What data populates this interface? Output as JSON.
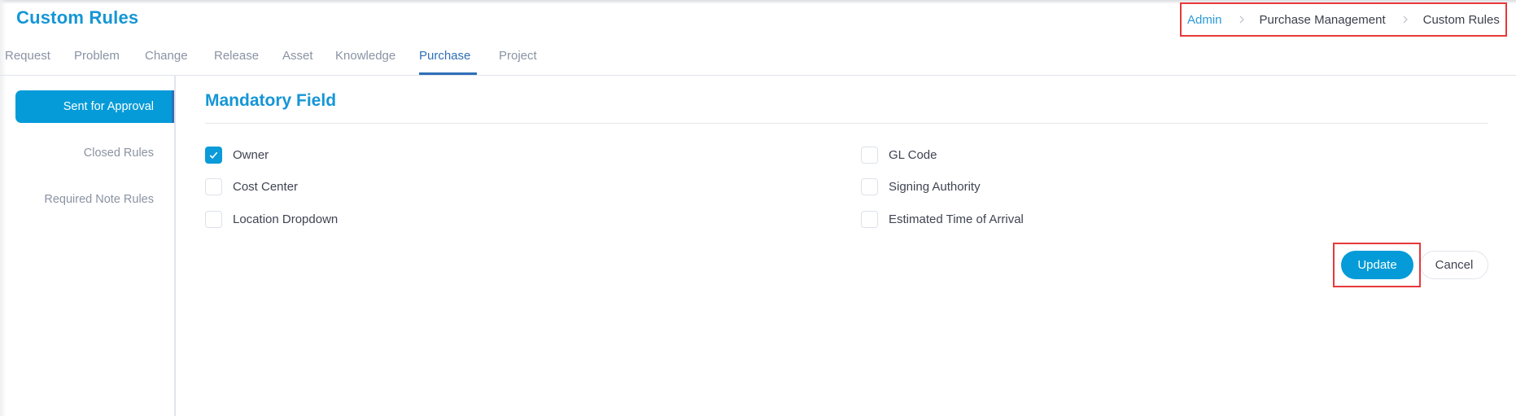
{
  "header": {
    "title": "Custom Rules",
    "breadcrumb": [
      {
        "label": "Admin",
        "link": true
      },
      {
        "label": "Purchase Management",
        "link": false
      },
      {
        "label": "Custom Rules",
        "link": false
      }
    ],
    "breadcrumb_separator_icon": "chevron-right-icon"
  },
  "tabs": [
    {
      "label": "Request",
      "active": false
    },
    {
      "label": "Problem",
      "active": false
    },
    {
      "label": "Change",
      "active": false
    },
    {
      "label": "Release",
      "active": false
    },
    {
      "label": "Asset",
      "active": false
    },
    {
      "label": "Knowledge",
      "active": false
    },
    {
      "label": "Purchase",
      "active": true
    },
    {
      "label": "Project",
      "active": false
    }
  ],
  "sidebar": {
    "items": [
      {
        "label": "Sent for Approval",
        "active": true
      },
      {
        "label": "Closed Rules",
        "active": false
      },
      {
        "label": "Required Note Rules",
        "active": false
      }
    ]
  },
  "main": {
    "section_title": "Mandatory Field",
    "fields_left": [
      {
        "label": "Owner",
        "checked": true
      },
      {
        "label": "Cost Center",
        "checked": false
      },
      {
        "label": "Location Dropdown",
        "checked": false
      }
    ],
    "fields_right": [
      {
        "label": "GL Code",
        "checked": false
      },
      {
        "label": "Signing Authority",
        "checked": false
      },
      {
        "label": "Estimated Time of Arrival",
        "checked": false
      }
    ],
    "update_label": "Update",
    "cancel_label": "Cancel"
  },
  "colors": {
    "accent": "#049bd8",
    "active_tab": "#2f6fb7",
    "highlight": "#e6393b"
  }
}
